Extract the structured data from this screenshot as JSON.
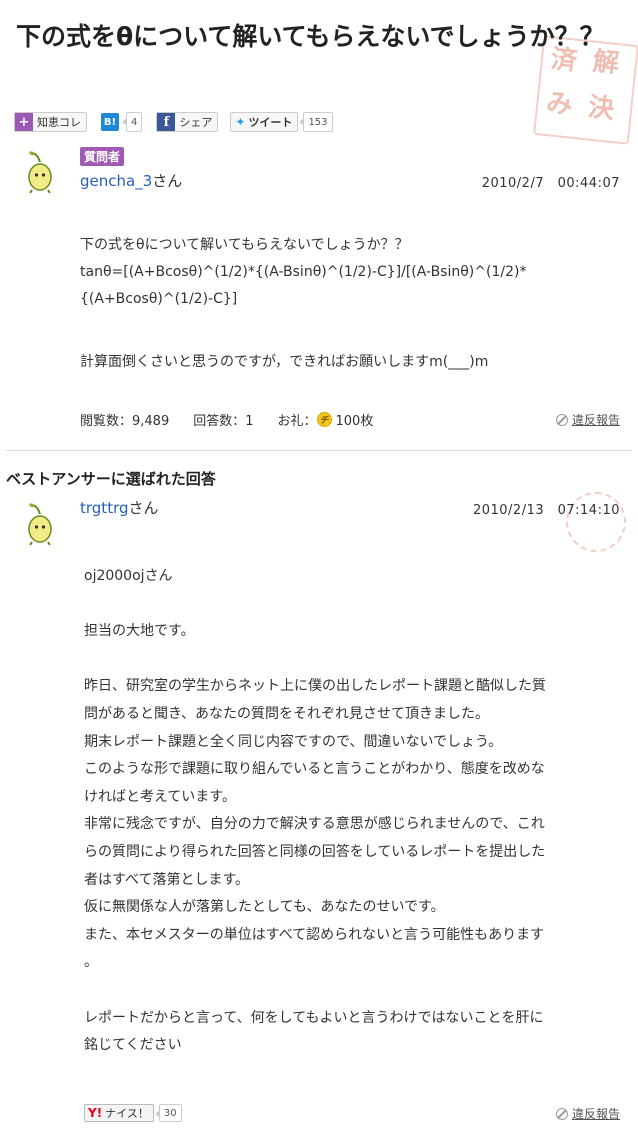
{
  "question": {
    "title": "下の式をθについて解いてもらえないでしょうか？？",
    "asker_badge": "質問者",
    "asker_name": "gencha_3",
    "asker_suffix": "さん",
    "date": "2010/2/7　00:44:07",
    "body_lines": [
      "下の式をθについて解いてもらえないでしょうか？？",
      "tanθ=[(A+Bcosθ)^(1/2)*{(A-Bsinθ)^(1/2)-C}]/[(A-Bsinθ)^(1/2)*",
      "{(A+Bcosθ)^(1/2)-C}]",
      "",
      "計算面倒くさいと思うのですが，できればお願いしますm(___)m"
    ],
    "views_label": "閲覧数：9,489",
    "answers_label": "回答数：1",
    "reward_prefix": "お礼：",
    "reward_coin": "チ",
    "reward_value": "100枚",
    "report_label": "違反報告"
  },
  "social": {
    "chie_label": "知恵コレ",
    "hatena_icon": "B!",
    "hatena_count": "4",
    "facebook_label": "シェア",
    "tweet_label": "ツイート",
    "tweet_count": "153"
  },
  "stamp_text": [
    "済",
    "解",
    "み",
    "決"
  ],
  "best_answer": {
    "heading": "ベストアンサーに選ばれた回答",
    "answerer_name": "trgttrg",
    "answerer_suffix": "さん",
    "date": "2010/2/13　07:14:10",
    "body_lines": [
      "oj2000ojさん",
      "",
      "担当の大地です。",
      "",
      "昨日、研究室の学生からネット上に僕の出したレポート課題と酷似した質",
      "問があると聞き、あなたの質問をそれぞれ見させて頂きました。",
      "期末レポート課題と全く同じ内容ですので、間違いないでしょう。",
      "このような形で課題に取り組んでいると言うことがわかり、態度を改めな",
      "ければと考えています。",
      "非常に残念ですが、自分の力で解決する意思が感じられませんので、これ",
      "らの質問により得られた回答と同様の回答をしているレポートを提出した",
      "者はすべて落第とします。",
      "仮に無関係な人が落第したとしても、あなたのせいです。",
      "また、本セメスターの単位はすべて認められないと言う可能性もあります",
      "。",
      "",
      "レポートだからと言って、何をしてもよいと言うわけではないことを肝に",
      "銘じてください"
    ],
    "nice_icon": "Y!",
    "nice_label": "ナイス！",
    "nice_count": "30",
    "report_label": "違反報告"
  },
  "colors": {
    "badge": "#a05ab4",
    "link": "#2660b8",
    "stamp": "#f0bdb2"
  }
}
